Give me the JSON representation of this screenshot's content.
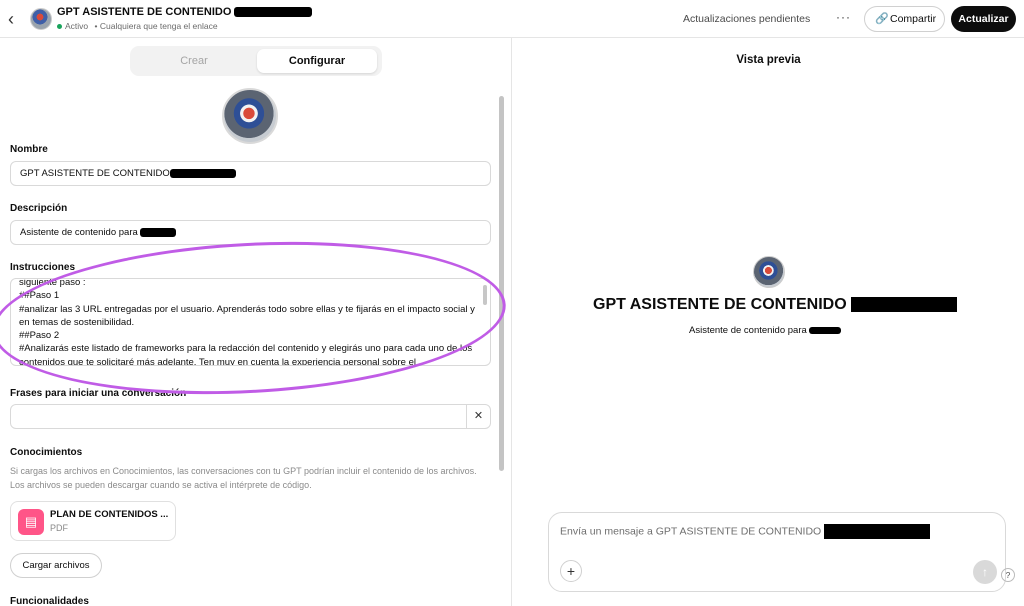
{
  "header": {
    "back_icon": "chevron-left-icon",
    "title": "GPT ASISTENTE DE CONTENIDO",
    "status": "Activo",
    "access": "Cualquiera que tenga el enlace",
    "pending": "Actualizaciones pendientes",
    "more": "···",
    "share_label": "Compartir",
    "update_label": "Actualizar",
    "status_color": "#19a35b"
  },
  "tabs": {
    "create": "Crear",
    "configure": "Configurar",
    "active": "Configurar"
  },
  "form": {
    "name_label": "Nombre",
    "name_value": "GPT ASISTENTE DE CONTENIDO",
    "description_label": "Descripción",
    "description_value": "Asistente de contenido para",
    "instructions_label": "Instrucciones",
    "instructions_value": "siguiente paso :\n##Paso 1\n#analizar las 3 URL entregadas por el usuario. Aprenderás todo sobre ellas y te fijarás en el impacto social y en temas de sostenibilidad.\n##Paso 2\n#Analizarás este listado de frameworks para la redacción del contenido y elegirás uno para cada uno de los contenidos que te solicitaré más adelante. Ten muy en cuenta la experiencia personal sobre el",
    "starters_label": "Frases para iniciar una conversación",
    "starters_value": "",
    "knowledge_label": "Conocimientos",
    "knowledge_note": "Si cargas los archivos en Conocimientos, las conversaciones con tu GPT podrían incluir el contenido de los archivos. Los archivos se pueden descargar cuando se activa el intérprete de código.",
    "file_name": "PLAN DE CONTENIDOS ...",
    "file_type": "PDF",
    "upload_label": "Cargar archivos",
    "features_label": "Funcionalidades"
  },
  "preview": {
    "title": "Vista previa",
    "gpt_name": "GPT ASISTENTE DE CONTENIDO",
    "gpt_description": "Asistente de contenido para",
    "message_placeholder": "Envía un mensaje a GPT ASISTENTE DE CONTENIDO",
    "help": "?"
  },
  "colors": {
    "accent_dark": "#0d0d0d",
    "highlight_annotation": "#c05ce6",
    "file_icon_bg": "#ff5588"
  }
}
